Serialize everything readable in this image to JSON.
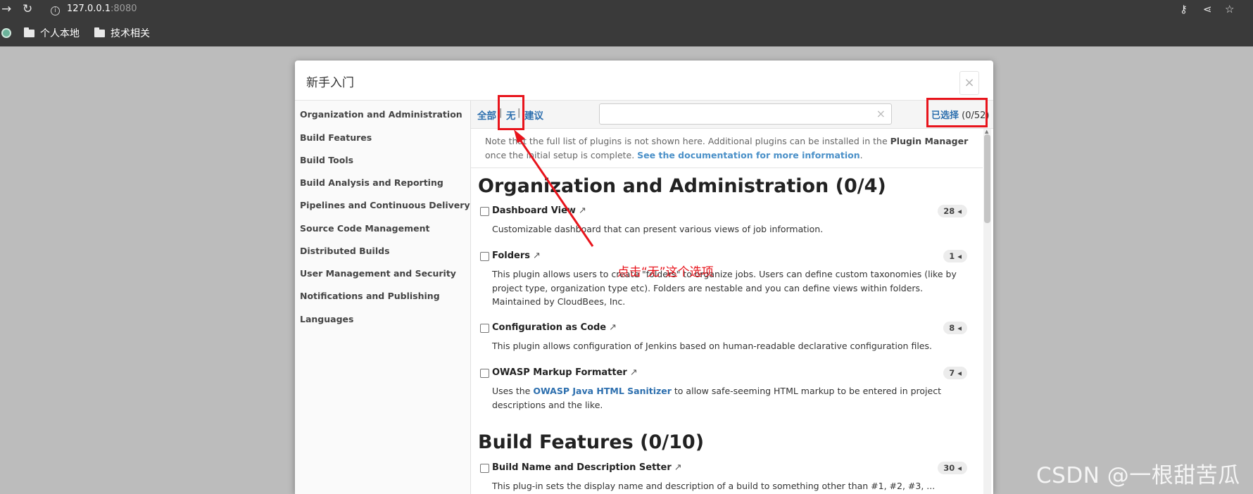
{
  "browser": {
    "url_host": "127.0.0.1",
    "url_port": ":8080",
    "bookmarks": [
      "个人本地",
      "技术相关"
    ]
  },
  "dialog": {
    "title": "新手入门",
    "close_label": "×"
  },
  "sidebar": {
    "items": [
      "Organization and Administration",
      "Build Features",
      "Build Tools",
      "Build Analysis and Reporting",
      "Pipelines and Continuous Delivery",
      "Source Code Management",
      "Distributed Builds",
      "User Management and Security",
      "Notifications and Publishing",
      "Languages"
    ]
  },
  "toolbar": {
    "all": "全部",
    "none": "无",
    "suggested": "建议",
    "separator": "|",
    "search_value": "",
    "clear": "×",
    "selected_label": "已选择",
    "selected_count": "(0/52)"
  },
  "note": {
    "text1": "Note that the full list of plugins is not shown here. Additional plugins can be installed in the ",
    "bold": "Plugin Manager",
    "text2": " once the initial setup is complete. ",
    "link": "See the documentation for more information",
    "text3": "."
  },
  "sections": [
    {
      "title": "Organization and Administration (0/4)",
      "plugins": [
        {
          "name": "Dashboard View",
          "deps": "28",
          "desc": "Customizable dashboard that can present various views of job information."
        },
        {
          "name": "Folders",
          "deps": "1",
          "desc": "This plugin allows users to create \"folders\" to organize jobs. Users can define custom taxonomies (like by project type, organization type etc). Folders are nestable and you can define views within folders. Maintained by CloudBees, Inc."
        },
        {
          "name": "Configuration as Code",
          "deps": "8",
          "desc": "This plugin allows configuration of Jenkins based on human-readable declarative configuration files."
        },
        {
          "name": "OWASP Markup Formatter",
          "deps": "7",
          "desc_pre": "Uses the ",
          "desc_link": "OWASP Java HTML Sanitizer",
          "desc_post": " to allow safe-seeming HTML markup to be entered in project descriptions and the like."
        }
      ]
    },
    {
      "title": "Build Features (0/10)",
      "plugins": [
        {
          "name": "Build Name and Description Setter",
          "deps": "30",
          "desc": "This plug-in sets the display name and description of a build to something other than #1, #2, #3, ..."
        }
      ]
    }
  ],
  "glyphs": {
    "external_link": "↗",
    "dep_arrow": "◂"
  },
  "annotation": {
    "text": "点击“无”这个选项",
    "color": "#e8141c"
  },
  "watermark": "CSDN @一根甜苦瓜"
}
